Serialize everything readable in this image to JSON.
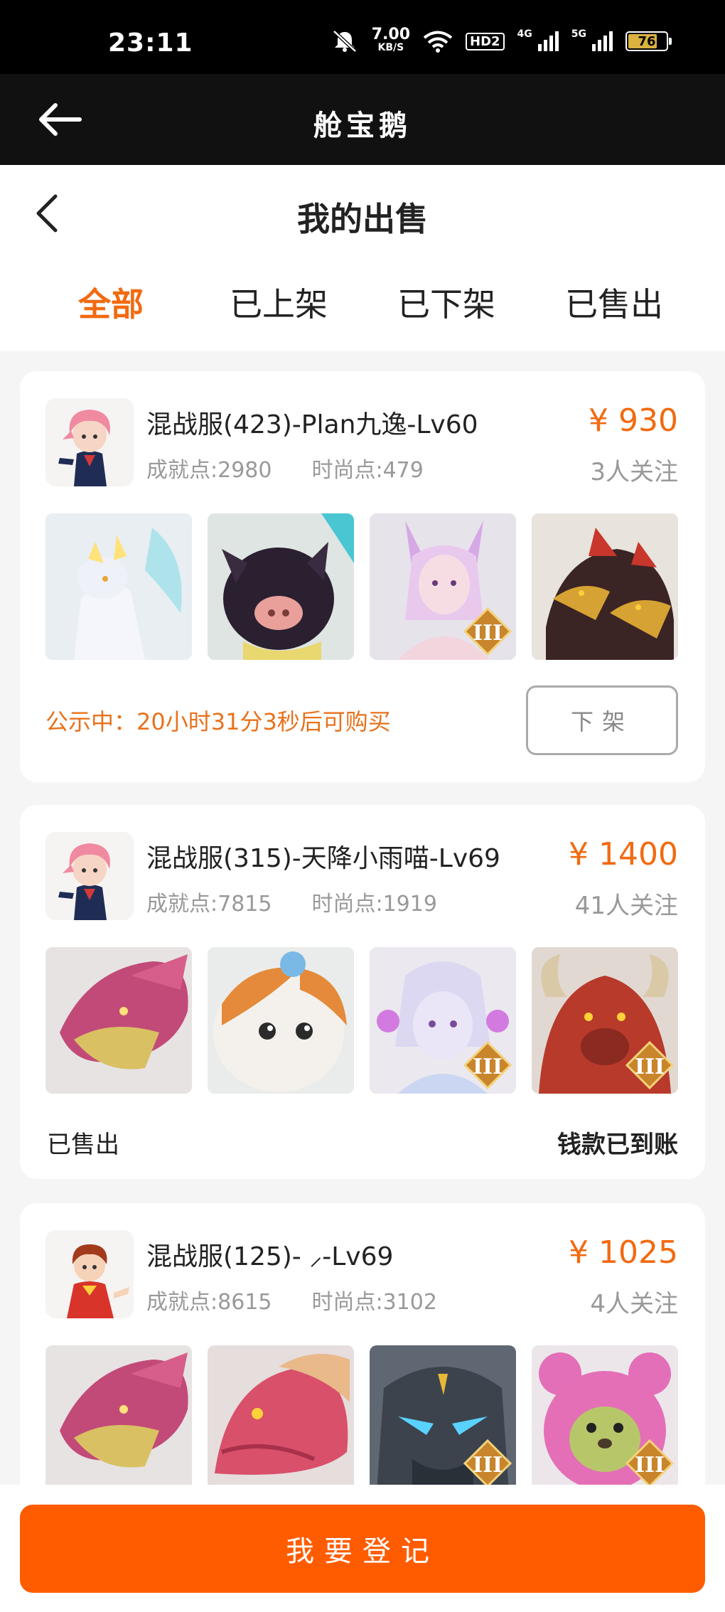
{
  "status_bar": {
    "time": "23:11",
    "net_speed": "7.00",
    "net_speed_unit": "KB/S",
    "hd": "HD2",
    "net1": "4G",
    "net2": "5G",
    "battery": "76",
    "icons": [
      "mute-icon",
      "wifi-icon",
      "signal-icon",
      "battery-icon"
    ]
  },
  "app_header": {
    "title": "舱宝鹅"
  },
  "page": {
    "title": "我的出售"
  },
  "tabs": [
    "全部",
    "已上架",
    "已下架",
    "已售出"
  ],
  "listings": [
    {
      "title": "混战服(423)-Plan九逸-Lv60",
      "achievement": "成就点:2980",
      "fashion": "时尚点:479",
      "price": "¥ 930",
      "follows": "3人关注",
      "notice": "公示中：20小时31分3秒后可购买",
      "action": "下架"
    },
    {
      "title": "混战服(315)-天降小雨喵-Lv69",
      "achievement": "成就点:7815",
      "fashion": "时尚点:1919",
      "price": "¥ 1400",
      "follows": "41人关注",
      "status_left": "已售出",
      "status_right": "钱款已到账"
    },
    {
      "title": "混战服(125)- ⸝-Lv69",
      "achievement": "成就点:8615",
      "fashion": "时尚点:3102",
      "price": "¥ 1025",
      "follows": "4人关注"
    }
  ],
  "bottom": {
    "button": "我要登记"
  },
  "colors": {
    "accent": "#f26a10",
    "button": "#ff5c00"
  }
}
